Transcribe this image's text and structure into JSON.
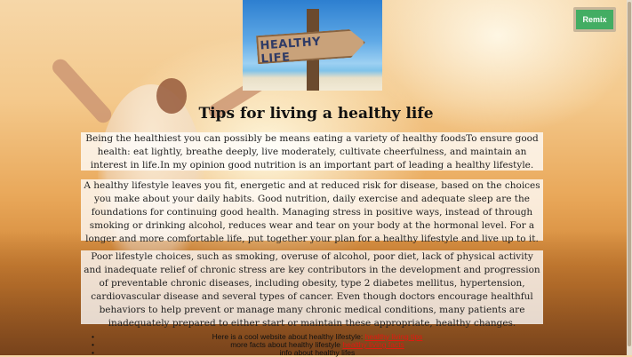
{
  "remix_label": "Remix",
  "hero_image": {
    "sign_text": "HEALTHY LIFE"
  },
  "title": "Tips for living a healthy life",
  "paragraphs": [
    "Being the healthiest you can possibly be means eating a variety of healthy foodsTo ensure good health: eat lightly, breathe deeply, live moderately, cultivate cheerfulness, and maintain an interest in life.In my opinion good nutrition is an important part of leading a healthy lifestyle.",
    "A healthy lifestyle leaves you fit, energetic and at reduced risk for disease, based on the choices you make about your daily habits. Good nutrition, daily exercise and adequate sleep are the foundations for continuing good health. Managing stress in positive ways, instead of through smoking or drinking alcohol, reduces wear and tear on your body at the hormonal level. For a longer and more comfortable life, put together your plan for a healthy lifestyle and live up to it.",
    "Poor lifestyle choices, such as smoking, overuse of alcohol, poor diet, lack of physical activity and inadequate relief of chronic stress are key contributors in the development and progression of preventable chronic diseases, including obesity, type 2 diabetes mellitus, hypertension, cardiovascular disease and several types of cancer. Even though doctors encourage healthful behaviors to help prevent or manage many chronic medical conditions, many patients are inadequately prepared to either start or maintain these appropriate, healthy changes."
  ],
  "links": [
    {
      "text": "Here is a cool website about healthy lifestyle:",
      "link_text": "healthy living tips"
    },
    {
      "text": "more facts about healthy lifestyle",
      "link_text": "healthy living facts"
    },
    {
      "text": "info about healthy lifes",
      "link_text": ""
    }
  ]
}
